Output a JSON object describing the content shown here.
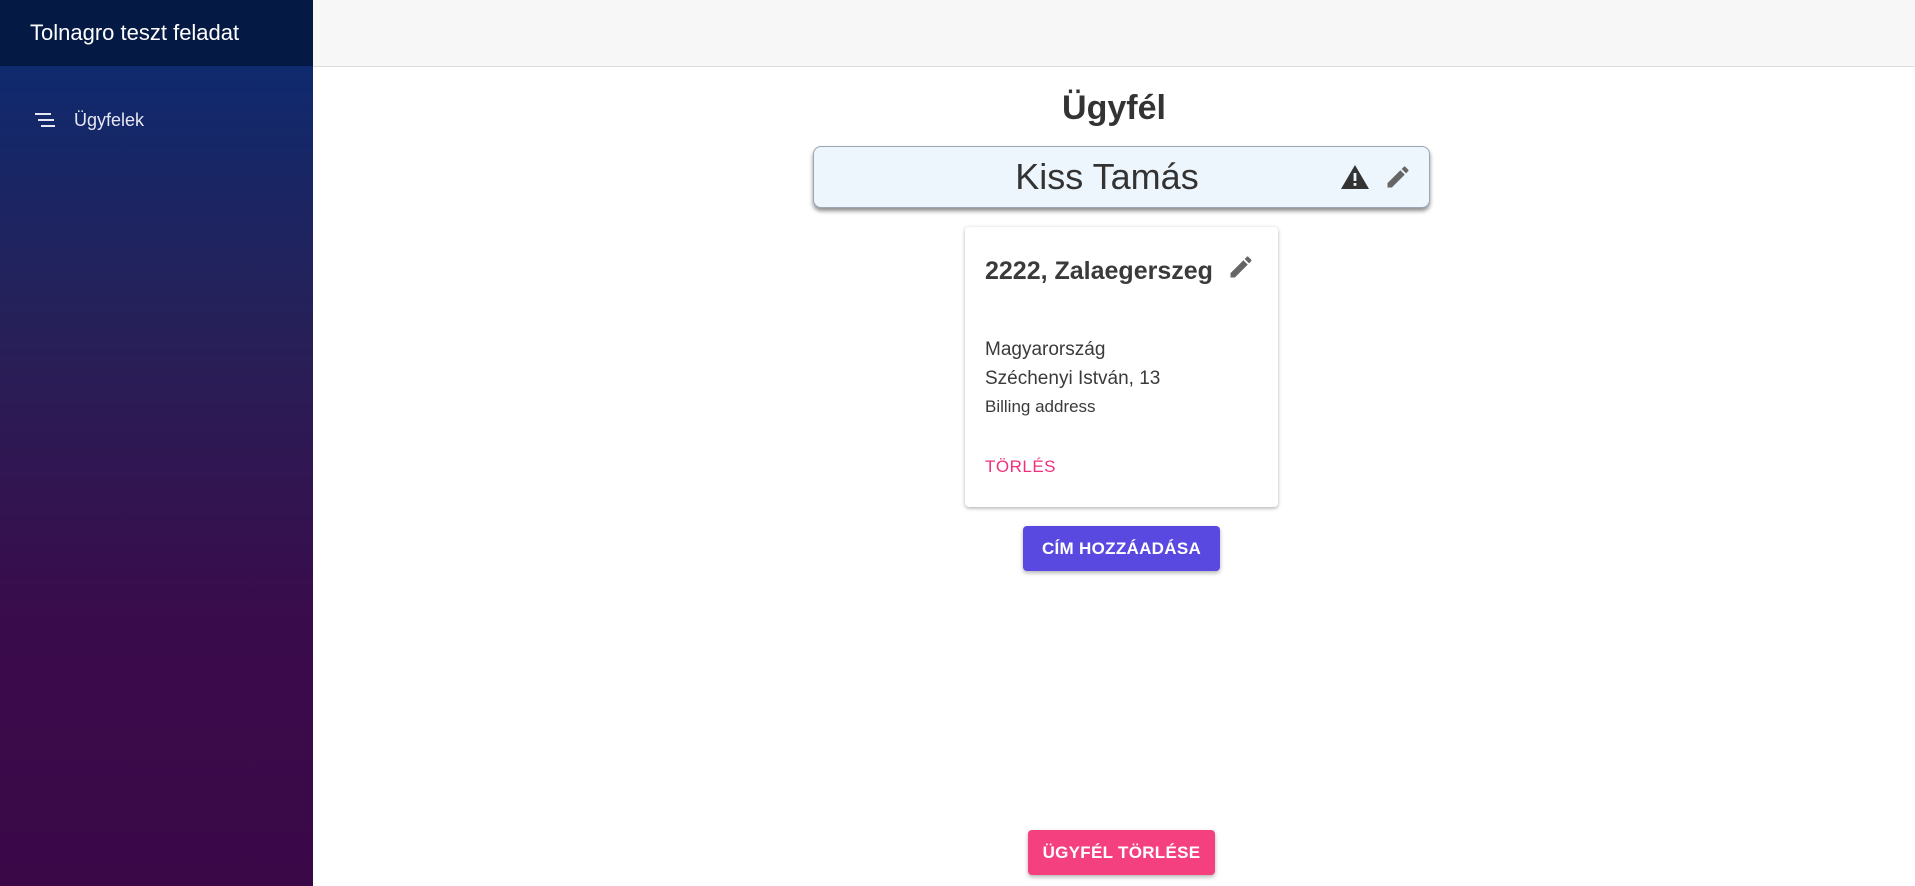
{
  "sidebar": {
    "app_title": "Tolnagro teszt feladat",
    "nav_items": [
      {
        "label": "Ügyfelek",
        "icon": "menu-lines-icon"
      }
    ]
  },
  "main": {
    "page_title": "Ügyfél",
    "customer_name": "Kiss Tamás",
    "name_icons": [
      "warning-icon",
      "edit-icon"
    ],
    "address_card": {
      "title": "2222, Zalaegerszeg",
      "country": "Magyarország",
      "street": "Széchenyi István, 13",
      "type": "Billing address",
      "delete_label": "TÖRLÉS"
    },
    "add_address_label": "CÍM HOZZÁADÁSA",
    "delete_customer_label": "ÜGYFÉL TÖRLÉSE"
  },
  "colors": {
    "sidebar_header": "#041943",
    "sidebar_gradient_top": "#0f2a6e",
    "sidebar_gradient_bottom": "#3a0847",
    "primary_button": "#5a49e0",
    "danger_button": "#f4407f",
    "danger_text": "#f0307d",
    "name_box_bg": "#eef6fd"
  }
}
